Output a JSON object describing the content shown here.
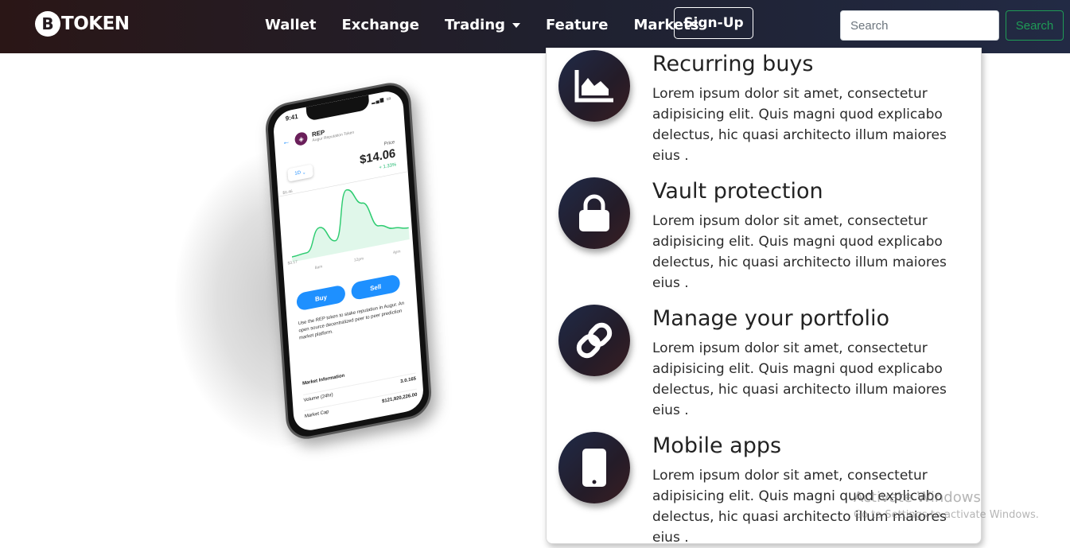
{
  "navbar": {
    "brand_symbol": "B",
    "brand_text": "TOKEN",
    "links": [
      {
        "label": "Wallet"
      },
      {
        "label": "Exchange"
      },
      {
        "label": "Trading",
        "dropdown": true
      },
      {
        "label": "Feature"
      },
      {
        "label": "Markets"
      }
    ],
    "signup_label": "Sign-Up",
    "search_placeholder": "Search",
    "search_button_label": "Search",
    "gradient_colors": [
      "#2a1616",
      "#1f2130",
      "#222a44"
    ],
    "search_button_color": "#1f9b56"
  },
  "phone": {
    "time": "9:41",
    "token_symbol": "REP",
    "token_name": "Augur Reputation Token",
    "timeframe": "1D",
    "price_label": "Price",
    "price": "$14.06",
    "change": "+ 1.33%",
    "chart_high": "$6.46",
    "chart_low": "$3.17",
    "chart_ticks": [
      "8am",
      "12pm",
      "4pm"
    ],
    "buy_label": "Buy",
    "sell_label": "Sell",
    "description": "Use the REP token to stake reputation in Augur. An open source decentralized peer to peer prediction market platform.",
    "market_title": "Market Information",
    "market_rows": [
      {
        "label": "Volume (24hr)",
        "value": "3.0.165"
      },
      {
        "label": "Market Cap",
        "value": "$121,920,226.00"
      }
    ],
    "chart_points": [
      0.08,
      0.1,
      0.45,
      0.2,
      0.95,
      0.7,
      0.3,
      0.22,
      0.18
    ],
    "chart_color": "#2ecc71"
  },
  "features": [
    {
      "icon": "area-chart-icon",
      "title": "Recurring buys",
      "text": "Lorem ipsum dolor sit amet, consectetur adipisicing elit. Quis magni quod explicabo delectus, hic quasi architecto illum maiores eius ."
    },
    {
      "icon": "lock-icon",
      "title": "Vault protection",
      "text": "Lorem ipsum dolor sit amet, consectetur adipisicing elit. Quis magni quod explicabo delectus, hic quasi architecto illum maiores eius ."
    },
    {
      "icon": "link-icon",
      "title": "Manage your portfolio",
      "text": "Lorem ipsum dolor sit amet, consectetur adipisicing elit. Quis magni quod explicabo delectus, hic quasi architecto illum maiores eius ."
    },
    {
      "icon": "mobile-phone-icon",
      "title": "Mobile apps",
      "text": "Lorem ipsum dolor sit amet, consectetur adipisicing elit. Quis magni quod explicabo delectus, hic quasi architecto illum maiores eius ."
    }
  ],
  "watermark": {
    "title": "Activate Windows",
    "subtitle": "Go to Settings to activate Windows."
  }
}
